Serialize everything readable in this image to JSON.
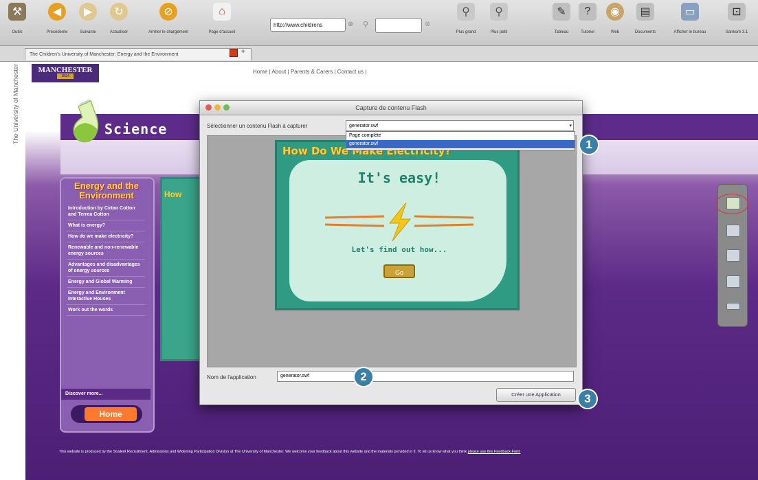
{
  "toolbar": {
    "buttons": [
      {
        "label": "Outils",
        "icon": "tools-icon",
        "color": "#8a7a5a"
      },
      {
        "label": "Précédente",
        "icon": "back-arrow-icon",
        "color": "#e8a020"
      },
      {
        "label": "Suivante",
        "icon": "forward-arrow-icon",
        "color": "#e0c890"
      },
      {
        "label": "Actualiser",
        "icon": "refresh-icon",
        "color": "#e0c890"
      },
      {
        "label": "Arrêter le chargement",
        "icon": "stop-icon",
        "color": "#e8a020"
      },
      {
        "label": "Page d'accueil",
        "icon": "home-icon",
        "color": "#f1f1f1"
      },
      {
        "label": "Plus grand",
        "icon": "zoom-in-icon",
        "color": "#c9c9c9"
      },
      {
        "label": "Plus petit",
        "icon": "zoom-out-icon",
        "color": "#c9c9c9"
      },
      {
        "label": "Tableau",
        "icon": "whiteboard-icon",
        "color": "#bfbfbf"
      },
      {
        "label": "Tutoriel",
        "icon": "tutorial-icon",
        "color": "#bfbfbf"
      },
      {
        "label": "Web",
        "icon": "globe-icon",
        "color": "#c8a46a"
      },
      {
        "label": "Documents",
        "icon": "documents-icon",
        "color": "#bfbfbf"
      },
      {
        "label": "Afficher le bureau",
        "icon": "desktop-icon",
        "color": "#8aa0c0"
      },
      {
        "label": "Sankoré 3.1",
        "icon": "app-icon",
        "color": "#bfbfbf"
      }
    ],
    "address": "http://www.childrens",
    "search_placeholder": ""
  },
  "tab": {
    "title": "The Children's University of Manchester: Energy and the Environment"
  },
  "page": {
    "university_text": "The University of Manchester",
    "logo": "MANCHESTER",
    "logo_sub": "1824",
    "nav": "Home | About | Parents & Carers | Contact us |",
    "science": "Science",
    "sidebar_title": "Energy and the Environment",
    "sidebar_items": [
      "Introduction by Cirtan Cotton and Terrea Cotton",
      "What is energy?",
      "How do we make electricity?",
      "Renewable and non-renewable energy sources",
      "Advantages and disadvantages of energy sources",
      "Energy and Global Warming",
      "Energy and Environment Interactive Houses",
      "Work out the words"
    ],
    "discover": "Discover more...",
    "home_button": "Home",
    "bg_game_title": "How",
    "footer_text": "This website is produced by the Student Recruitment, Admissions and Widening Participation Division at The University of Manchester. We welcome your feedback about this website and the materials provided in it. To let us know what you think",
    "footer_link": "please use this Feedback Form"
  },
  "dialog": {
    "title": "Capture de contenu Flash",
    "select_label": "Sélectionner un contenu Flash à capturer",
    "selected": "generator.swf",
    "options": [
      "Page complète",
      "generator.swf"
    ],
    "preview": {
      "title": "How Do We Make Electricity?",
      "easy": "It's easy!",
      "find": "Let's find out how...",
      "go": "Go"
    },
    "app_label": "Nom de l'application",
    "app_value": "generator.swf",
    "create_button": "Créer une Application"
  },
  "badges": [
    "1",
    "2",
    "3"
  ],
  "colors": {
    "purple_dark": "#5b2a86",
    "purple_light": "#8a5eb0",
    "badge": "#3a7fa8",
    "teal": "#2f9b83",
    "highlight_ring": "#dd3333"
  }
}
